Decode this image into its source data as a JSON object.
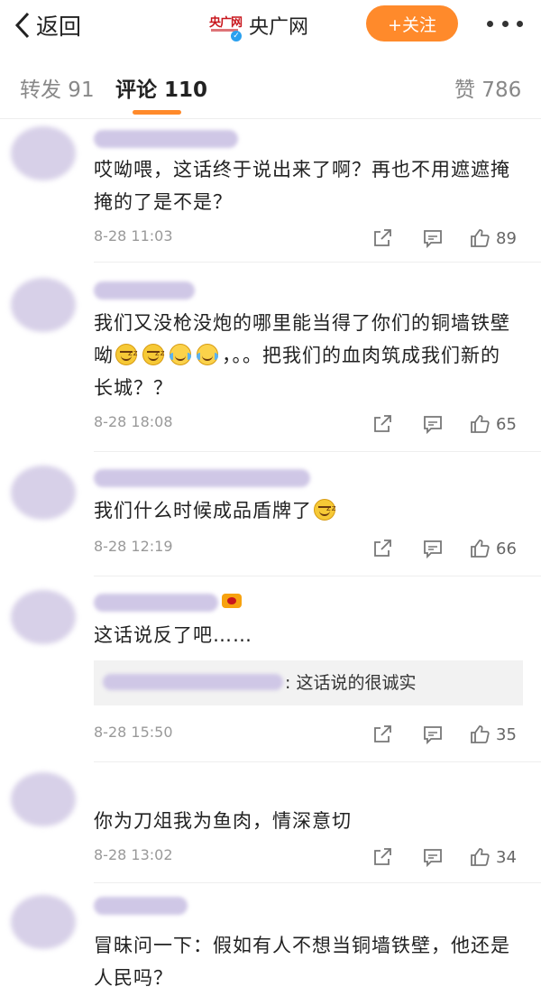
{
  "header": {
    "back_label": "返回",
    "brand_logo_text": "央广网",
    "brand_name": "央广网",
    "follow_label": "+关注"
  },
  "tabs": {
    "repost": "转发 91",
    "comments": "评论 110",
    "likes": "赞 786"
  },
  "comments": [
    {
      "text": "哎呦喂，这话终于说出来了啊？再也不用遮遮掩掩的了是不是？",
      "date": "8-28 11:03",
      "likes": "89"
    },
    {
      "text_before": "我们又没枪没炮的哪里能当得了你们的铜墙铁壁呦",
      "text_after": "，。。把我们的血肉筑成我们新的长城？？",
      "date": "8-28 18:08",
      "likes": "65"
    },
    {
      "text": "我们什么时候成品盾牌了",
      "date": "8-28 12:19",
      "likes": "66"
    },
    {
      "text": "这话说反了吧……",
      "reply": ": 这话说的很诚实",
      "date": "8-28 15:50",
      "likes": "35"
    },
    {
      "text": "你为刀俎我为鱼肉，情深意切",
      "date": "8-28 13:02",
      "likes": "34"
    },
    {
      "text": "冒昧问一下：假如有人不想当铜墙铁壁，他还是人民吗？"
    }
  ],
  "icons": {
    "back": "chevron-left-icon",
    "share": "share-square-icon",
    "comment": "comment-bubble-icon",
    "like": "thumbs-up-icon",
    "more": "more-dots-icon"
  },
  "colors": {
    "accent": "#ff8a2b",
    "brand_red": "#c8161d"
  }
}
